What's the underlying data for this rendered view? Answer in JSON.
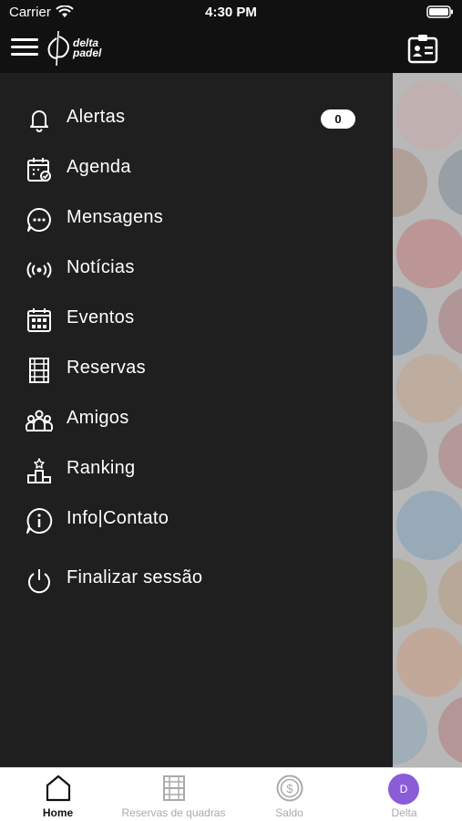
{
  "status_bar": {
    "carrier": "Carrier",
    "time": "4:30 PM"
  },
  "header": {
    "logo_text_line1": "delta",
    "logo_text_line2": "padel"
  },
  "menu": {
    "items": [
      {
        "label": "Alertas",
        "icon": "bell-icon"
      },
      {
        "label": "Agenda",
        "icon": "calendar-check-icon"
      },
      {
        "label": "Mensagens",
        "icon": "chat-icon"
      },
      {
        "label": "Notícias",
        "icon": "broadcast-icon"
      },
      {
        "label": "Eventos",
        "icon": "calendar-grid-icon"
      },
      {
        "label": "Reservas",
        "icon": "court-icon"
      },
      {
        "label": "Amigos",
        "icon": "people-icon"
      },
      {
        "label": "Ranking",
        "icon": "podium-icon"
      },
      {
        "label": "Info|Contato",
        "icon": "info-icon"
      },
      {
        "label": "Finalizar sessão",
        "icon": "power-icon"
      }
    ],
    "alert_count": "0"
  },
  "tabs": [
    {
      "label": "Home",
      "icon": "home-icon",
      "active": true
    },
    {
      "label": "Reservas de quadras",
      "icon": "court-icon",
      "active": false
    },
    {
      "label": "Saldo",
      "icon": "coin-icon",
      "active": false
    },
    {
      "label": "Delta",
      "icon": "avatar",
      "avatar_letter": "D",
      "active": false
    }
  ],
  "colors": {
    "drawer_bg": "#1f1f1f",
    "header_bg": "#111111",
    "avatar": "#8a5cd8",
    "tab_active": "#111111",
    "tab_inactive": "#aaaaaa"
  }
}
